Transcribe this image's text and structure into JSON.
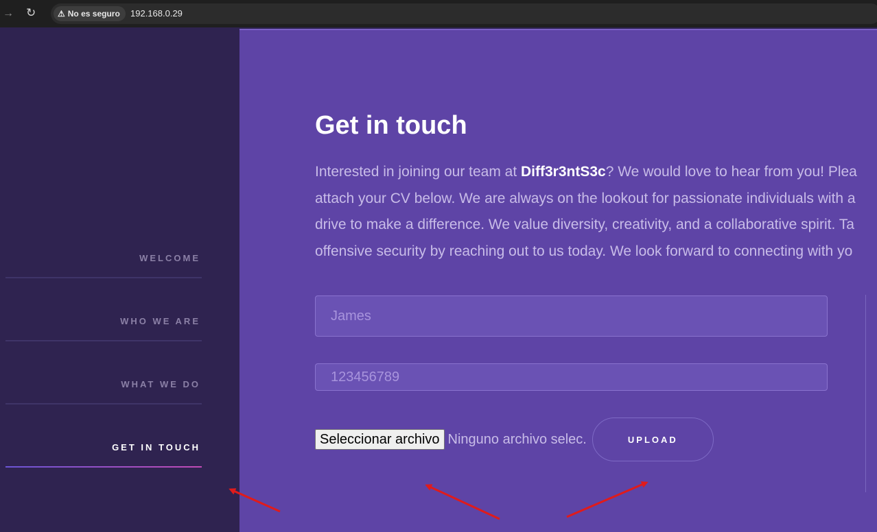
{
  "browser": {
    "security_label": "No es seguro",
    "url": "192.168.0.29"
  },
  "sidebar": {
    "items": [
      {
        "label": "WELCOME"
      },
      {
        "label": "WHO WE ARE"
      },
      {
        "label": "WHAT WE DO"
      },
      {
        "label": "GET IN TOUCH",
        "active": true
      }
    ]
  },
  "main": {
    "title": "Get in touch",
    "intro": {
      "line1_before": "Interested in joining our team at ",
      "company": "Diff3r3ntS3c",
      "line1_after": "? We would love to hear from you! Plea",
      "line2": "attach your CV below. We are always on the lookout for passionate individuals with a",
      "line3": "drive to make a difference. We value diversity, creativity, and a collaborative spirit. Ta",
      "line4": "offensive security by reaching out to us today. We look forward to connecting with yo"
    },
    "form": {
      "name_placeholder": "James",
      "phone_placeholder": "123456789",
      "file_button_label": "Seleccionar archivo",
      "file_status": "Ninguno archivo selec.",
      "upload_label": "UPLOAD"
    }
  },
  "colors": {
    "sidebar_bg": "#2f2350",
    "main_bg": "#5e44a6",
    "annotation_arrow": "#e01b1b"
  }
}
